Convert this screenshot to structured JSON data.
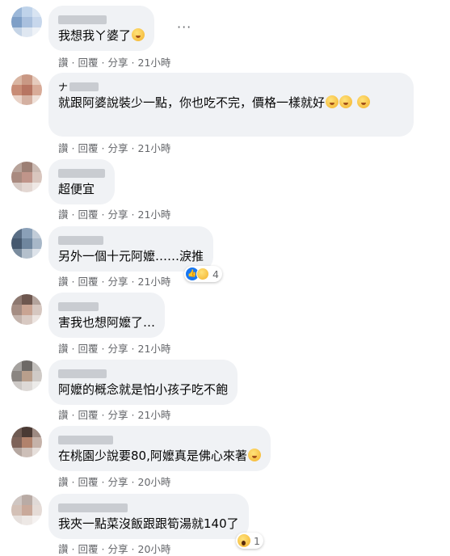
{
  "actions": {
    "like": "讚",
    "reply": "回覆",
    "share": "分享",
    "sep": "·"
  },
  "more_icon": "ellipsis-icon",
  "comments": [
    {
      "text": "我想我ㄚ婆了",
      "emoji": "sad-face-emoji",
      "time": "21小時"
    },
    {
      "text": "就跟阿婆說裝少一點，你也吃不完，價格一樣就好",
      "emoji": "thinking-face-emoji",
      "time": "21小時"
    },
    {
      "text": "超便宜",
      "time": "21小時"
    },
    {
      "text": "另外一個十元阿嬤……淚推",
      "time": "21小時",
      "reaction_count": "4",
      "reactions": [
        "like",
        "sad"
      ]
    },
    {
      "text": "害我也想阿嬤了…",
      "time": "21小時"
    },
    {
      "text": "阿嬤的概念就是怕小孩子吃不飽",
      "time": "21小時"
    },
    {
      "text": "在桃園少說要80,阿嬤真是佛心來著",
      "emoji": "smiling-face-emoji",
      "time": "20小時"
    },
    {
      "text": "我夾一點菜沒飯跟跟筍湯就140了",
      "time": "20小時",
      "reaction_count": "1",
      "reactions": [
        "wow"
      ]
    }
  ],
  "colors": {
    "bubble": "#f0f2f5",
    "meta": "#65676b",
    "like_blue": "#1877f2"
  }
}
